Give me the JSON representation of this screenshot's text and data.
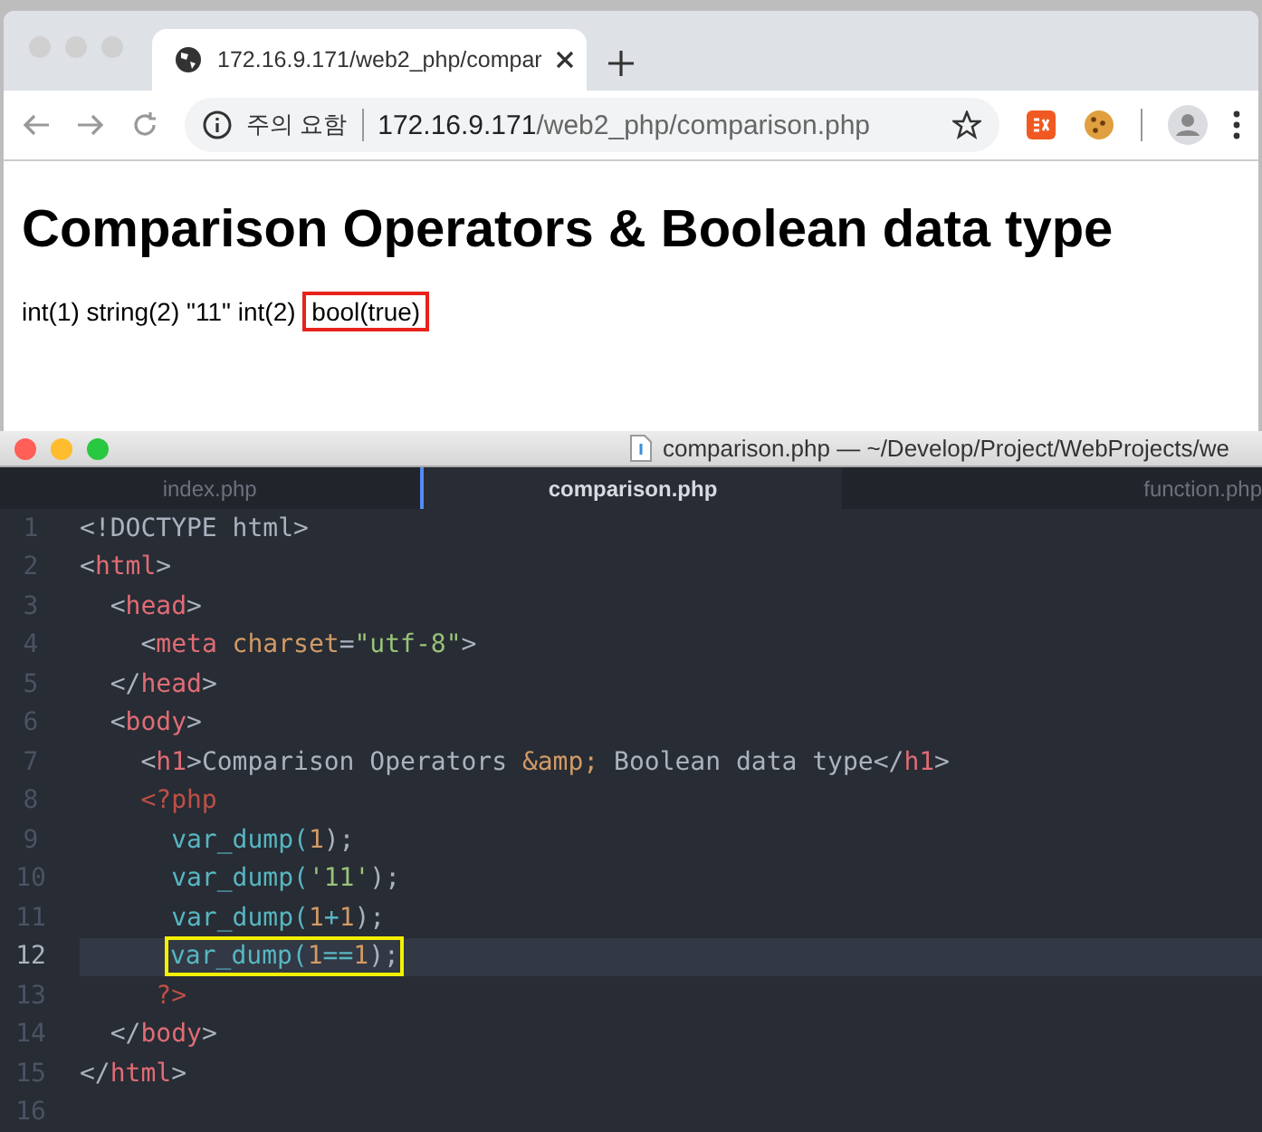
{
  "browser": {
    "tab": {
      "title": "172.16.9.171/web2_php/compar",
      "selected": true
    },
    "address": {
      "security": "주의 요함",
      "host": "172.16.9.171",
      "path": "/web2_php/comparison.php"
    },
    "page": {
      "heading": "Comparison Operators & Boolean data type",
      "output": [
        {
          "text": "int(1) string(2) \"11\" int(2)",
          "boxed": false
        },
        {
          "text": "bool(true)",
          "boxed": true
        }
      ]
    }
  },
  "editor": {
    "title": "comparison.php — ~/Develop/Project/WebProjects/we",
    "tabs": [
      {
        "label": "index.php",
        "selected": false
      },
      {
        "label": "comparison.php",
        "selected": true
      },
      {
        "label": "function.php",
        "selected": false
      }
    ],
    "lines": [
      {
        "number": "1",
        "current": false,
        "boxed": false,
        "tokens": [
          {
            "kind": "plain",
            "text": "<!DOCTYPE html>"
          }
        ]
      },
      {
        "number": "2",
        "current": false,
        "boxed": false,
        "tokens": [
          {
            "kind": "punct",
            "text": "<"
          },
          {
            "kind": "tag",
            "text": "html"
          },
          {
            "kind": "punct",
            "text": ">"
          }
        ]
      },
      {
        "number": "3",
        "current": false,
        "boxed": false,
        "tokens": [
          {
            "kind": "punct",
            "text": "  <"
          },
          {
            "kind": "tag",
            "text": "head"
          },
          {
            "kind": "punct",
            "text": ">"
          }
        ]
      },
      {
        "number": "4",
        "current": false,
        "boxed": false,
        "tokens": [
          {
            "kind": "punct",
            "text": "    <"
          },
          {
            "kind": "tag",
            "text": "meta"
          },
          {
            "kind": "attr",
            "text": " charset"
          },
          {
            "kind": "punct",
            "text": "="
          },
          {
            "kind": "string",
            "text": "\"utf-8\""
          },
          {
            "kind": "punct",
            "text": ">"
          }
        ]
      },
      {
        "number": "5",
        "current": false,
        "boxed": false,
        "tokens": [
          {
            "kind": "punct",
            "text": "  </"
          },
          {
            "kind": "tag",
            "text": "head"
          },
          {
            "kind": "punct",
            "text": ">"
          }
        ]
      },
      {
        "number": "6",
        "current": false,
        "boxed": false,
        "tokens": [
          {
            "kind": "punct",
            "text": "  <"
          },
          {
            "kind": "tag",
            "text": "body"
          },
          {
            "kind": "punct",
            "text": ">"
          }
        ]
      },
      {
        "number": "7",
        "current": false,
        "boxed": false,
        "tokens": [
          {
            "kind": "punct",
            "text": "    <"
          },
          {
            "kind": "tag",
            "text": "h1"
          },
          {
            "kind": "punct",
            "text": ">Comparison Operators "
          },
          {
            "kind": "attr",
            "text": "&amp;"
          },
          {
            "kind": "punct",
            "text": " Boolean data type</"
          },
          {
            "kind": "tag",
            "text": "h1"
          },
          {
            "kind": "punct",
            "text": ">"
          }
        ]
      },
      {
        "number": "8",
        "current": false,
        "boxed": false,
        "tokens": [
          {
            "kind": "php",
            "text": "    <?php"
          }
        ]
      },
      {
        "number": "9",
        "current": false,
        "boxed": false,
        "tokens": [
          {
            "kind": "func",
            "text": "      var_dump("
          },
          {
            "kind": "number",
            "text": "1"
          },
          {
            "kind": "punct",
            "text": ");"
          }
        ]
      },
      {
        "number": "10",
        "current": false,
        "boxed": false,
        "tokens": [
          {
            "kind": "func",
            "text": "      var_dump("
          },
          {
            "kind": "string",
            "text": "'11'"
          },
          {
            "kind": "punct",
            "text": ");"
          }
        ]
      },
      {
        "number": "11",
        "current": false,
        "boxed": false,
        "tokens": [
          {
            "kind": "func",
            "text": "      var_dump("
          },
          {
            "kind": "number",
            "text": "1"
          },
          {
            "kind": "func",
            "text": "+"
          },
          {
            "kind": "number",
            "text": "1"
          },
          {
            "kind": "punct",
            "text": ");"
          }
        ]
      },
      {
        "number": "12",
        "current": true,
        "boxed": true,
        "tokens": [
          {
            "kind": "func",
            "text": "var_dump("
          },
          {
            "kind": "number",
            "text": "1"
          },
          {
            "kind": "func",
            "text": "=="
          },
          {
            "kind": "number",
            "text": "1"
          },
          {
            "kind": "punct",
            "text": ");"
          }
        ]
      },
      {
        "number": "13",
        "current": false,
        "boxed": false,
        "tokens": [
          {
            "kind": "php",
            "text": "     ?>"
          }
        ]
      },
      {
        "number": "14",
        "current": false,
        "boxed": false,
        "tokens": [
          {
            "kind": "punct",
            "text": "  </"
          },
          {
            "kind": "tag",
            "text": "body"
          },
          {
            "kind": "punct",
            "text": ">"
          }
        ]
      },
      {
        "number": "15",
        "current": false,
        "boxed": false,
        "tokens": [
          {
            "kind": "punct",
            "text": "</"
          },
          {
            "kind": "tag",
            "text": "html"
          },
          {
            "kind": "punct",
            "text": ">"
          }
        ]
      },
      {
        "number": "16",
        "current": false,
        "boxed": false
      }
    ]
  }
}
